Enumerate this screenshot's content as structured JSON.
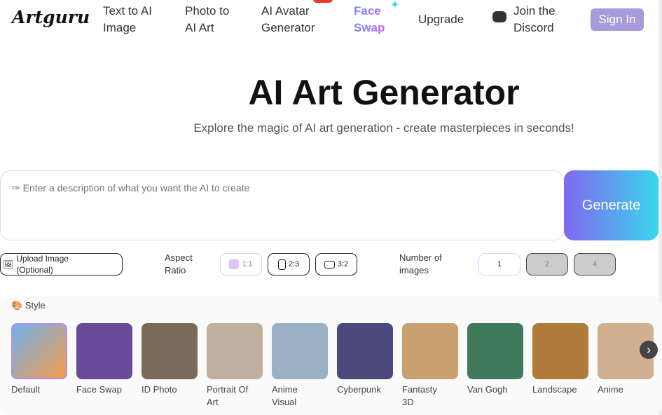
{
  "nav": {
    "logo": "Artguru",
    "items": [
      {
        "l1": "Text to AI",
        "l2": "Image"
      },
      {
        "l1": "Photo to",
        "l2": "AI Art"
      },
      {
        "l1": "AI Avatar",
        "l2": "Generator"
      },
      {
        "l1": "Face",
        "l2": "Swap"
      }
    ],
    "upgrade": "Upgrade",
    "discord1": "Join the",
    "discord2": "Discord",
    "signin": "Sign In"
  },
  "hero": {
    "title": "AI Art Generator",
    "subtitle": "Explore the magic of AI art generation - create masterpieces in seconds!"
  },
  "prompt": {
    "placeholder": "✑ Enter a description of what you want the AI to create",
    "generate": "Generate"
  },
  "controls": {
    "upload1": "Upload Image",
    "upload2": "(Optional)",
    "aspect1": "Aspect",
    "aspect2": "Ratio",
    "ratios": [
      "1:1",
      "2:3",
      "3:2"
    ],
    "num1": "Number of",
    "num2": "images",
    "counts": [
      "1",
      "2",
      "4"
    ]
  },
  "style": {
    "label": "Style",
    "icon": "palette-icon",
    "items": [
      {
        "n1": "Default",
        "n2": "",
        "bg": "linear-gradient(135deg,#6fb4ea,#f59a4e)"
      },
      {
        "n1": "Face Swap",
        "n2": "",
        "bg": "#6a4a9a"
      },
      {
        "n1": "ID Photo",
        "n2": "",
        "bg": "#7a6a5a"
      },
      {
        "n1": "Portrait Of",
        "n2": "Art",
        "bg": "#c0b0a0"
      },
      {
        "n1": "Anime",
        "n2": "Visual",
        "bg": "#9ab0c4"
      },
      {
        "n1": "Cyberpunk",
        "n2": "",
        "bg": "#4a4a7a"
      },
      {
        "n1": "Fantasty",
        "n2": "3D",
        "bg": "#c9a070"
      },
      {
        "n1": "Van Gogh",
        "n2": "",
        "bg": "#3f7a5a"
      },
      {
        "n1": "Landscape",
        "n2": "",
        "bg": "#b07a3a"
      },
      {
        "n1": "Anime",
        "n2": "",
        "bg": "#d0b090"
      }
    ]
  }
}
